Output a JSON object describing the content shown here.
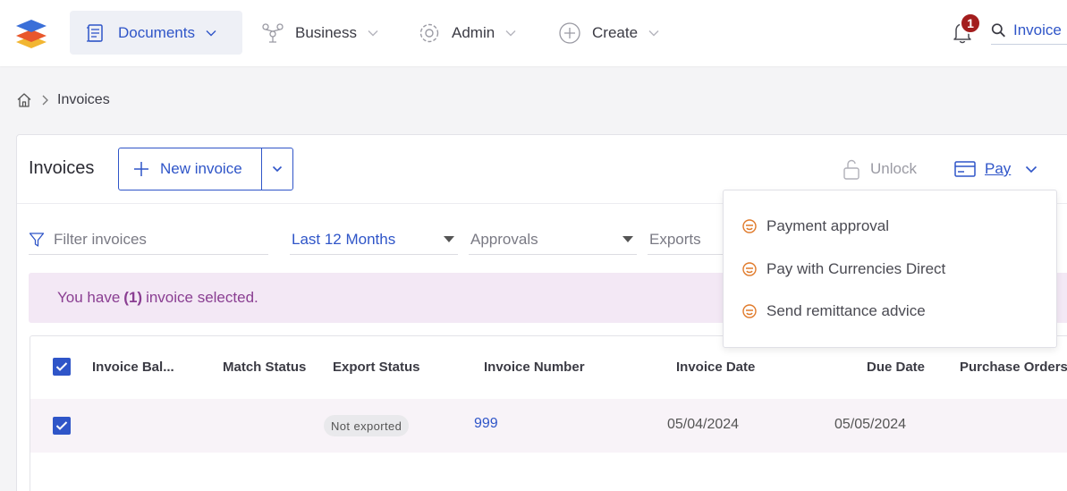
{
  "nav": {
    "documents": "Documents",
    "business": "Business",
    "admin": "Admin",
    "create": "Create",
    "notifications_count": "1",
    "search_value": "Invoice"
  },
  "breadcrumb": {
    "current": "Invoices"
  },
  "panel": {
    "title": "Invoices",
    "new_invoice": "New invoice",
    "unlock": "Unlock",
    "pay": "Pay"
  },
  "filters": {
    "filter_placeholder": "Filter invoices",
    "period": "Last 12 Months",
    "approvals": "Approvals",
    "exports": "Exports"
  },
  "selection": {
    "prefix": "You have",
    "count": "(1)",
    "suffix": "invoice selected."
  },
  "table": {
    "columns": [
      "Invoice Bal...",
      "Match Status",
      "Export Status",
      "Invoice Number",
      "Invoice Date",
      "Due Date",
      "Purchase Orders"
    ],
    "rows": [
      {
        "balance": "",
        "match_status": "",
        "export_status": "Not exported",
        "invoice_number": "999",
        "invoice_date": "05/04/2024",
        "due_date": "05/05/2024",
        "purchase_orders": ""
      }
    ]
  },
  "pay_menu": {
    "items": [
      "Payment approval",
      "Pay with Currencies Direct",
      "Send remittance advice"
    ]
  },
  "colors": {
    "accent": "#2f55c8",
    "selection_bg": "#f3e8f5",
    "selection_text": "#8a3e92",
    "badge_red": "#a31d1d",
    "menu_icon": "#e07a2a"
  }
}
